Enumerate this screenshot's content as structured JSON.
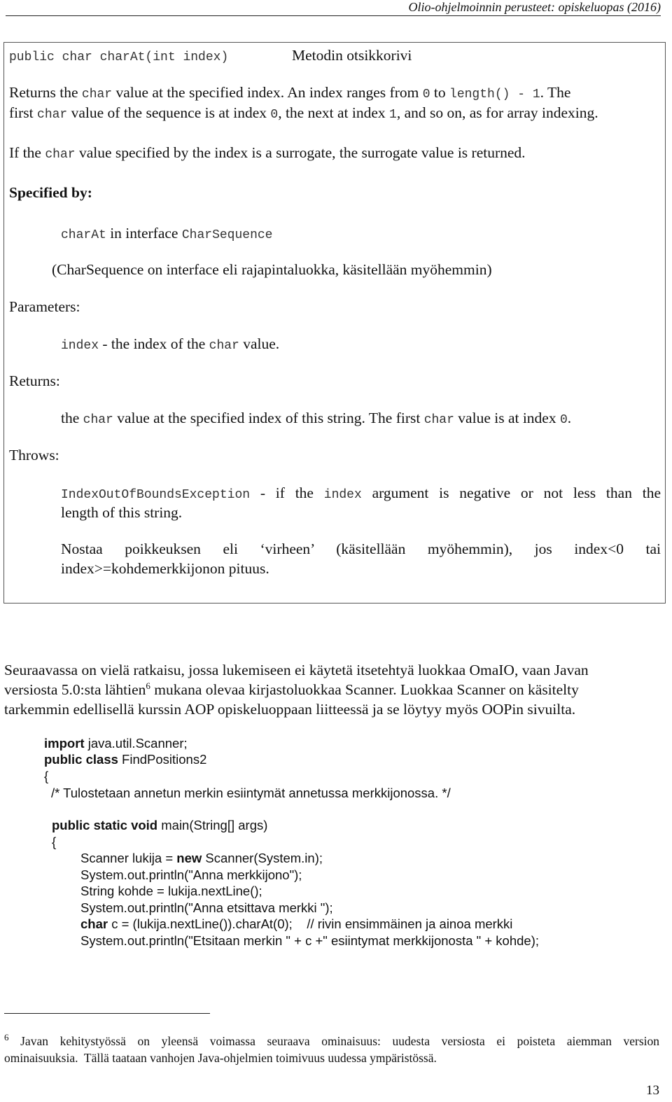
{
  "header": {
    "running_title": "Olio-ohjelmoinnin perusteet: opiskeluopas (2016)"
  },
  "api_doc": {
    "signature": "public char charAt(int index)",
    "signature_note": "Metodin otsikkorivi",
    "desc1": {
      "p1": "Returns the ",
      "c1": "char",
      "p2": " value at the specified index. An index ranges from ",
      "c2": "0",
      "p3": " to ",
      "c3": "length() - 1",
      "p4": ". The",
      "p5": "first ",
      "c4": "char",
      "p6": " value of the sequence is at index ",
      "c5": "0",
      "p7": ", the next at index ",
      "c6": "1",
      "p8": ", and so on, as for array indexing."
    },
    "desc2": {
      "p1": "If the ",
      "c1": "char",
      "p2": " value specified by the index is a surrogate, the surrogate value is returned."
    },
    "specified_by": {
      "label": "Specified by:",
      "c1": "charAt",
      "p1": " in interface ",
      "c2": "CharSequence",
      "note": "(CharSequence on interface eli rajapintaluokka, käsitellään myöhemmin)"
    },
    "parameters": {
      "label": "Parameters:",
      "c1": "index",
      "p1": " - the index of the ",
      "c2": "char",
      "p2": " value."
    },
    "returns": {
      "label": "Returns:",
      "p1": "the ",
      "c1": "char",
      "p2": " value at the specified index of this string. The first ",
      "c2": "char",
      "p3": " value is at index ",
      "c3": "0",
      "p4": "."
    },
    "throws": {
      "label": "Throws:",
      "c1": "IndexOutOfBoundsException",
      "p1": " - if the ",
      "c2": "index",
      "p2": " argument is negative or not less than the",
      "p3": "length of this string.",
      "note_line1": "Nostaa poikkeuksen eli ‘virheen’ (käsitellään myöhemmin), jos index<0 tai",
      "note_line2": "index>=kohdemerkkijonon pituus."
    }
  },
  "body_paragraph": {
    "line1": "Seuraavassa on vielä ratkaisu, jossa lukemiseen ei käytetä itsetehtyä luokkaa OmaIO, vaan Javan",
    "line2a": "versiosta 5.0:sta lähtien",
    "footnote_ref": "6",
    "line2b": " mukana olevaa kirjastoluokkaa Scanner. Luokkaa Scanner on käsitelty",
    "line3": "tarkemmin edellisellä kurssin AOP opiskeluoppaan liitteessä ja se löytyy myös OOPin sivuilta."
  },
  "code": {
    "l1_kw": "import",
    "l1": " java.util.Scanner;",
    "l2_kw": "public class",
    "l2": " FindPositions2",
    "l3": "{",
    "l4": "/* Tulostetaan annetun merkin esiintymät annetussa merkkijonossa. */",
    "l5_kw": "public static void",
    "l5": " main(String[] args)",
    "l6": "{",
    "l7a": "Scanner lukija = ",
    "l7_kw": "new",
    "l7b": " Scanner(System.in);",
    "l8": "System.out.println(\"Anna merkkijono\");",
    "l9": "String kohde = lukija.nextLine();",
    "l10": "System.out.println(\"Anna etsittava merkki \");",
    "l11_kw": "char",
    "l11": " c = (lukija.nextLine()).charAt(0);    // rivin ensimmäinen ja ainoa merkki",
    "l12": "System.out.println(\"Etsitaan merkin \" + c +\" esiintymat merkkijonosta \" + kohde);"
  },
  "footnote": {
    "marker": "6",
    "text1": " Javan kehitystyössä on yleensä voimassa seuraava ominaisuus: uudesta versiosta ei poisteta aiemman version",
    "text2": "ominaisuuksia.  Tällä taataan vanhojen Java-ohjelmien toimivuus uudessa ympäristössä."
  },
  "page_number": "13"
}
